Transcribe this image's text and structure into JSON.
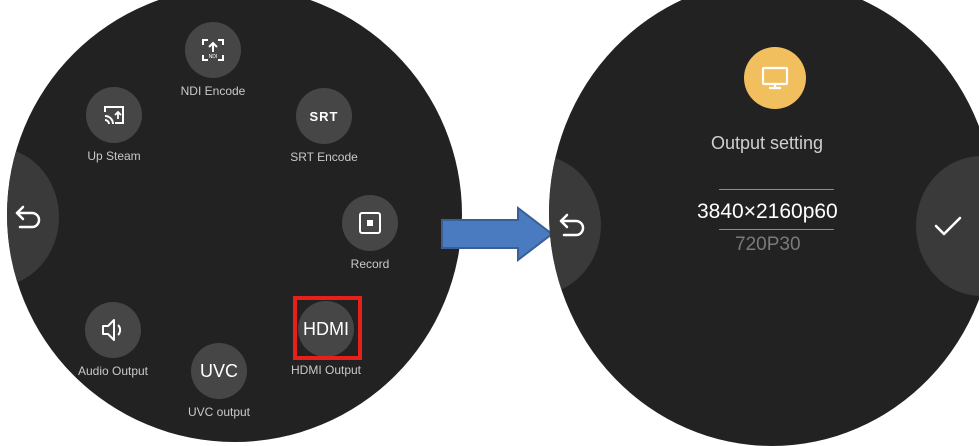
{
  "menu": {
    "items": [
      {
        "id": "ndi",
        "label": "NDI Encode",
        "icon": "ndi-upload-icon",
        "icon_text": "NDI"
      },
      {
        "id": "up-steam",
        "label": "Up Steam",
        "icon": "cast-icon"
      },
      {
        "id": "srt",
        "label": "SRT Encode",
        "icon": "srt-icon",
        "icon_text": "SRT"
      },
      {
        "id": "record",
        "label": "Record",
        "icon": "record-icon"
      },
      {
        "id": "audio",
        "label": "Audio Output",
        "icon": "speaker-icon"
      },
      {
        "id": "uvc",
        "label": "UVC output",
        "icon_text": "UVC"
      },
      {
        "id": "hdmi",
        "label": "HDMI Output",
        "icon_text": "HDMI"
      }
    ],
    "highlight": {
      "target": "hdmi",
      "color": "#e8201a"
    }
  },
  "output_setting": {
    "title": "Output setting",
    "icon": "monitor-icon",
    "current_resolution": "3840×2160p60",
    "next_resolution": "720P30"
  },
  "colors": {
    "dial": "#232222",
    "button": "#474646",
    "accent": "#f2bf5e",
    "arrow": "#4a7abf"
  },
  "icons": {
    "back": "back-arrow-icon",
    "confirm": "check-icon",
    "flow": "flow-arrow-icon"
  }
}
